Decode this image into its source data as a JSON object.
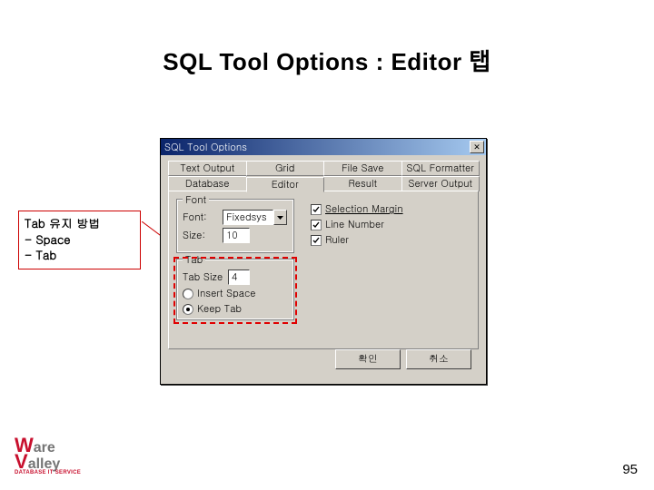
{
  "slide": {
    "title": "SQL Tool Options : Editor 탭",
    "page_number": "95"
  },
  "callout": {
    "line1": " Tab 유지 방법",
    "line2": "- Space",
    "line3": "- Tab"
  },
  "dialog": {
    "title": "SQL Tool Options",
    "close_glyph": "✕",
    "tabs_row1": [
      "Text Output",
      "Grid",
      "File Save",
      "SQL Formatter"
    ],
    "tabs_row2": [
      "Database",
      "Editor",
      "Result",
      "Server Output"
    ],
    "active_tab_index_row2": 1,
    "font_group": {
      "title": "Font",
      "font_label": "Font:",
      "font_value": "Fixedsys",
      "size_label": "Size:",
      "size_value": "10"
    },
    "tab_group": {
      "title": "Tab",
      "tabsize_label": "Tab Size",
      "tabsize_value": "4",
      "radio_insert": "Insert Space",
      "radio_keep": "Keep Tab",
      "selected_radio": "keep"
    },
    "right_checks": {
      "selection_margin": {
        "label": "Selection Margin",
        "checked": true
      },
      "line_number": {
        "label": "Line Number",
        "checked": true
      },
      "ruler": {
        "label": "Ruler",
        "checked": true
      }
    },
    "buttons": {
      "ok": "확인",
      "cancel": "취소"
    }
  },
  "logo": {
    "brand_w": "W",
    "brand_are": "are",
    "brand_v": "V",
    "brand_alley": "alley",
    "sub": "DATABASE IT SERVICE"
  }
}
